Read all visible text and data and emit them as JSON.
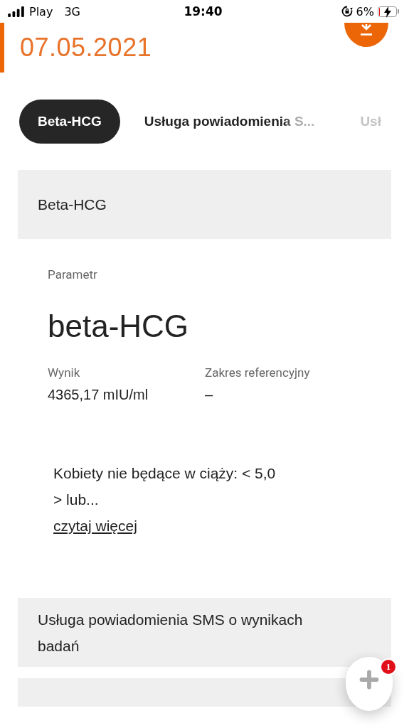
{
  "status_bar": {
    "carrier": "Play",
    "network": "3G",
    "time": "19:40",
    "battery_percent": "6%",
    "charging": true
  },
  "header": {
    "date": "07.05.2021"
  },
  "tabs": [
    {
      "label": "Beta-HCG",
      "selected": true
    },
    {
      "label": "Usługa powiadomienia S...",
      "selected": false
    },
    {
      "label": "Usł",
      "selected": false
    }
  ],
  "sections": [
    {
      "title": "Beta-HCG",
      "parameter_label": "Parametr",
      "parameter": "beta-HCG",
      "result_label": "Wynik",
      "result": "4365,17 mIU/ml",
      "range_label": "Zakres referencyjny",
      "range": "–",
      "note": "Kobiety nie będące w ciąży: < 5,0 > lub...",
      "more_link": "czytaj więcej"
    },
    {
      "title": "Usługa powiadomienia SMS o wynikach badań"
    }
  ],
  "chat_button": {
    "badge": "1"
  }
}
